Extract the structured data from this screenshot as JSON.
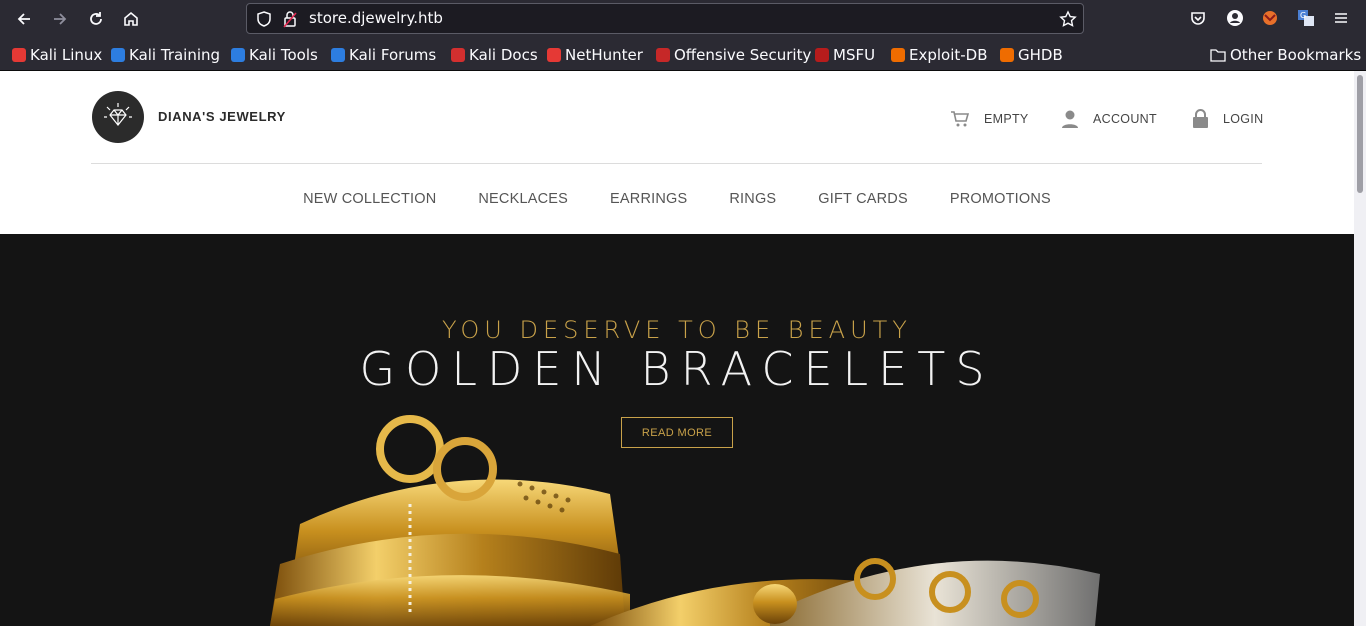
{
  "browser": {
    "url": "store.djewelry.htb",
    "bookmarks": [
      {
        "label": "Kali Linux",
        "icon": "kali-icon",
        "color": "#e53935"
      },
      {
        "label": "Kali Training",
        "icon": "kali-training-icon",
        "color": "#2d7de0"
      },
      {
        "label": "Kali Tools",
        "icon": "kali-tools-icon",
        "color": "#2d7de0"
      },
      {
        "label": "Kali Forums",
        "icon": "kali-forums-icon",
        "color": "#2d7de0"
      },
      {
        "label": "Kali Docs",
        "icon": "kali-docs-icon",
        "color": "#d32f2f"
      },
      {
        "label": "NetHunter",
        "icon": "nethunter-icon",
        "color": "#e53935"
      },
      {
        "label": "Offensive Security",
        "icon": "offsec-icon",
        "color": "#c62828"
      },
      {
        "label": "MSFU",
        "icon": "msfu-icon",
        "color": "#b71c1c"
      },
      {
        "label": "Exploit-DB",
        "icon": "exploit-db-icon",
        "color": "#ef6c00"
      },
      {
        "label": "GHDB",
        "icon": "ghdb-icon",
        "color": "#ef6c00"
      }
    ],
    "other_bookmarks": "Other Bookmarks"
  },
  "site": {
    "brand": "DIANA'S JEWELRY",
    "cart_label": "EMPTY",
    "account_label": "ACCOUNT",
    "login_label": "LOGIN",
    "menu": [
      {
        "label": "NEW COLLECTION"
      },
      {
        "label": "NECKLACES"
      },
      {
        "label": "EARRINGS"
      },
      {
        "label": "RINGS"
      },
      {
        "label": "GIFT CARDS"
      },
      {
        "label": "PROMOTIONS"
      }
    ]
  },
  "hero": {
    "subtitle": "YOU DESERVE TO BE BEAUTY",
    "title": "GOLDEN BRACELETS",
    "button": "READ MORE",
    "accent_color": "#c9a24a"
  }
}
